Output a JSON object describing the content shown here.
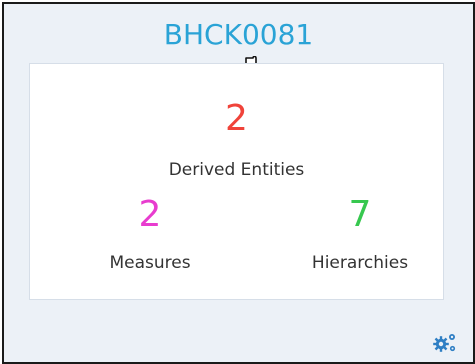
{
  "card": {
    "title": "BHCK0081"
  },
  "stats": {
    "derived": {
      "value": "2",
      "label": "Derived Entities",
      "color": "#f0433a"
    },
    "measures": {
      "value": "2",
      "label": "Measures",
      "color": "#e83ccf"
    },
    "hierarchies": {
      "value": "7",
      "label": "Hierarchies",
      "color": "#37c84f"
    }
  },
  "icons": {
    "cursor": "hand-pointer-icon",
    "settings": "gears-icon"
  },
  "colors": {
    "title": "#2aa3d6",
    "card_background": "#ecf1f7",
    "gear": "#2f7fc4"
  }
}
